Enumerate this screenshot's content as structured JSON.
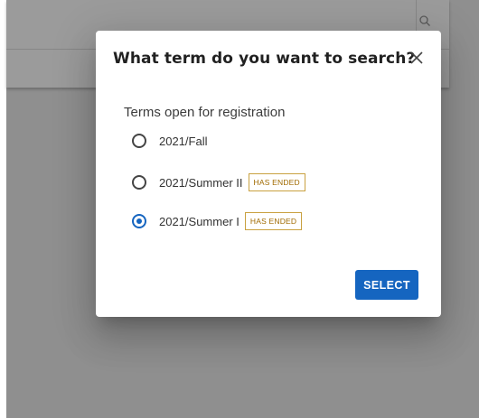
{
  "dialog": {
    "title": "What term do you want to search?",
    "section_label": "Terms open for registration",
    "options": [
      {
        "label": "2021/Fall",
        "badge": "",
        "selected": false
      },
      {
        "label": "2021/Summer II",
        "badge": "HAS ENDED",
        "selected": false
      },
      {
        "label": "2021/Summer I",
        "badge": "HAS ENDED",
        "selected": true
      }
    ],
    "select_label": "SELECT",
    "close_icon": "close-icon"
  },
  "colors": {
    "primary": "#1565c0",
    "badge_text": "#a06a00",
    "badge_border": "#c9a140",
    "backdrop": "#8f8f8f"
  },
  "background": {
    "search_icon": "search-icon"
  }
}
